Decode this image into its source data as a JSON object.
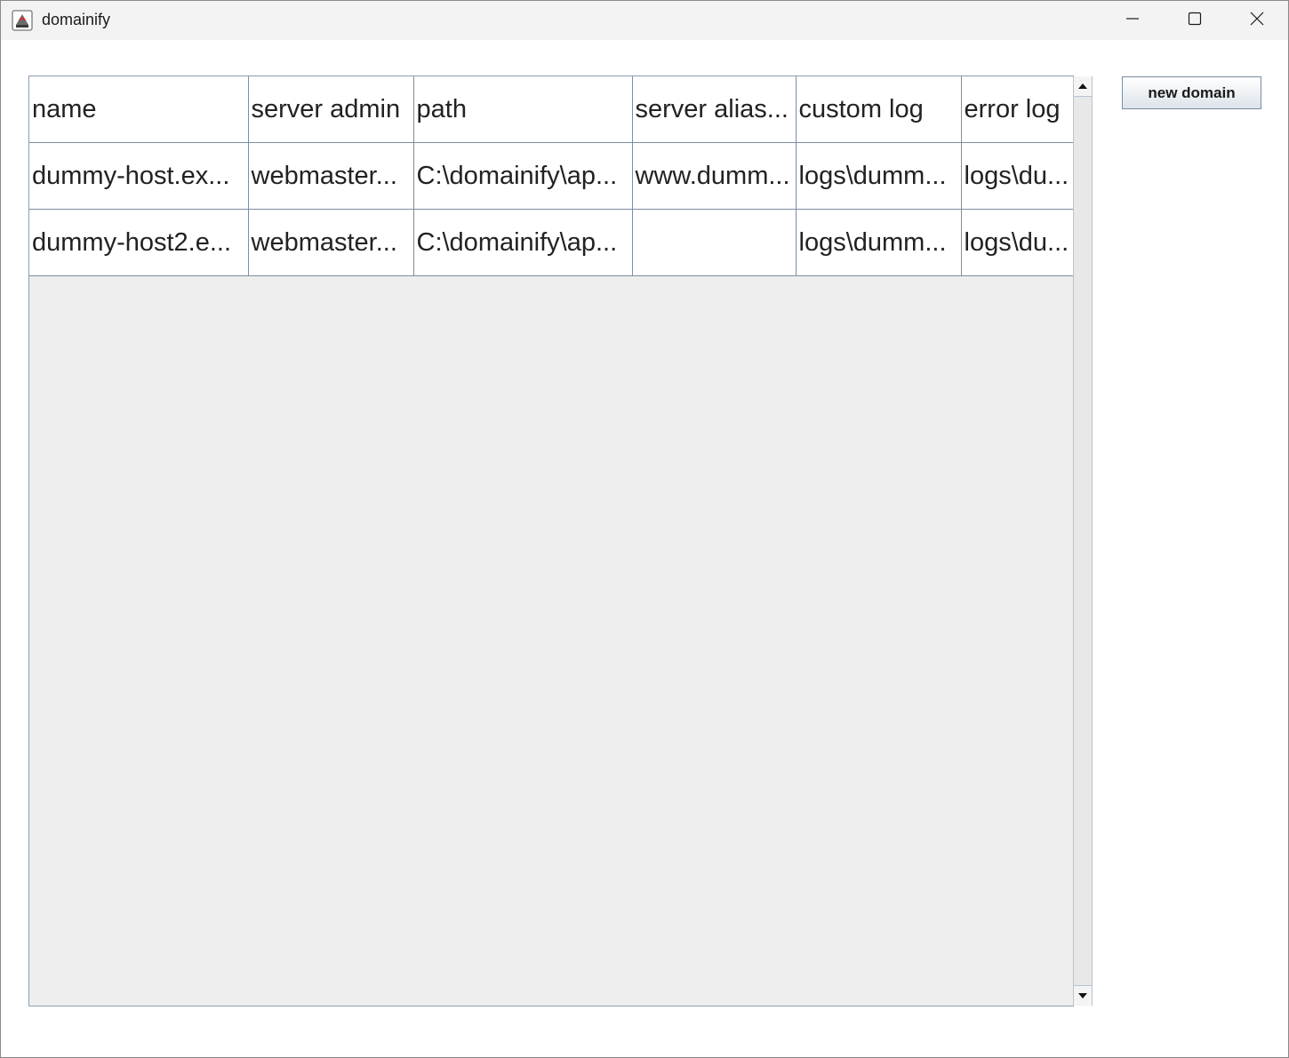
{
  "window": {
    "title": "domainify"
  },
  "toolbar": {
    "new_domain_label": "new domain"
  },
  "table": {
    "columns": [
      "name",
      "server admin",
      "path",
      "server alias...",
      "custom log",
      "error log"
    ],
    "rows": [
      [
        "dummy-host.ex...",
        "webmaster...",
        "C:\\domainify\\ap...",
        "www.dumm...",
        "logs\\dumm...",
        "logs\\du..."
      ],
      [
        "dummy-host2.e...",
        "webmaster...",
        "C:\\domainify\\ap...",
        "",
        "logs\\dumm...",
        "logs\\du..."
      ]
    ]
  },
  "icons": {
    "app": "java-cup-icon",
    "minimize": "minimize-icon",
    "maximize": "maximize-icon",
    "close": "close-icon",
    "scroll_up": "arrow-up-icon",
    "scroll_down": "arrow-down-icon"
  }
}
